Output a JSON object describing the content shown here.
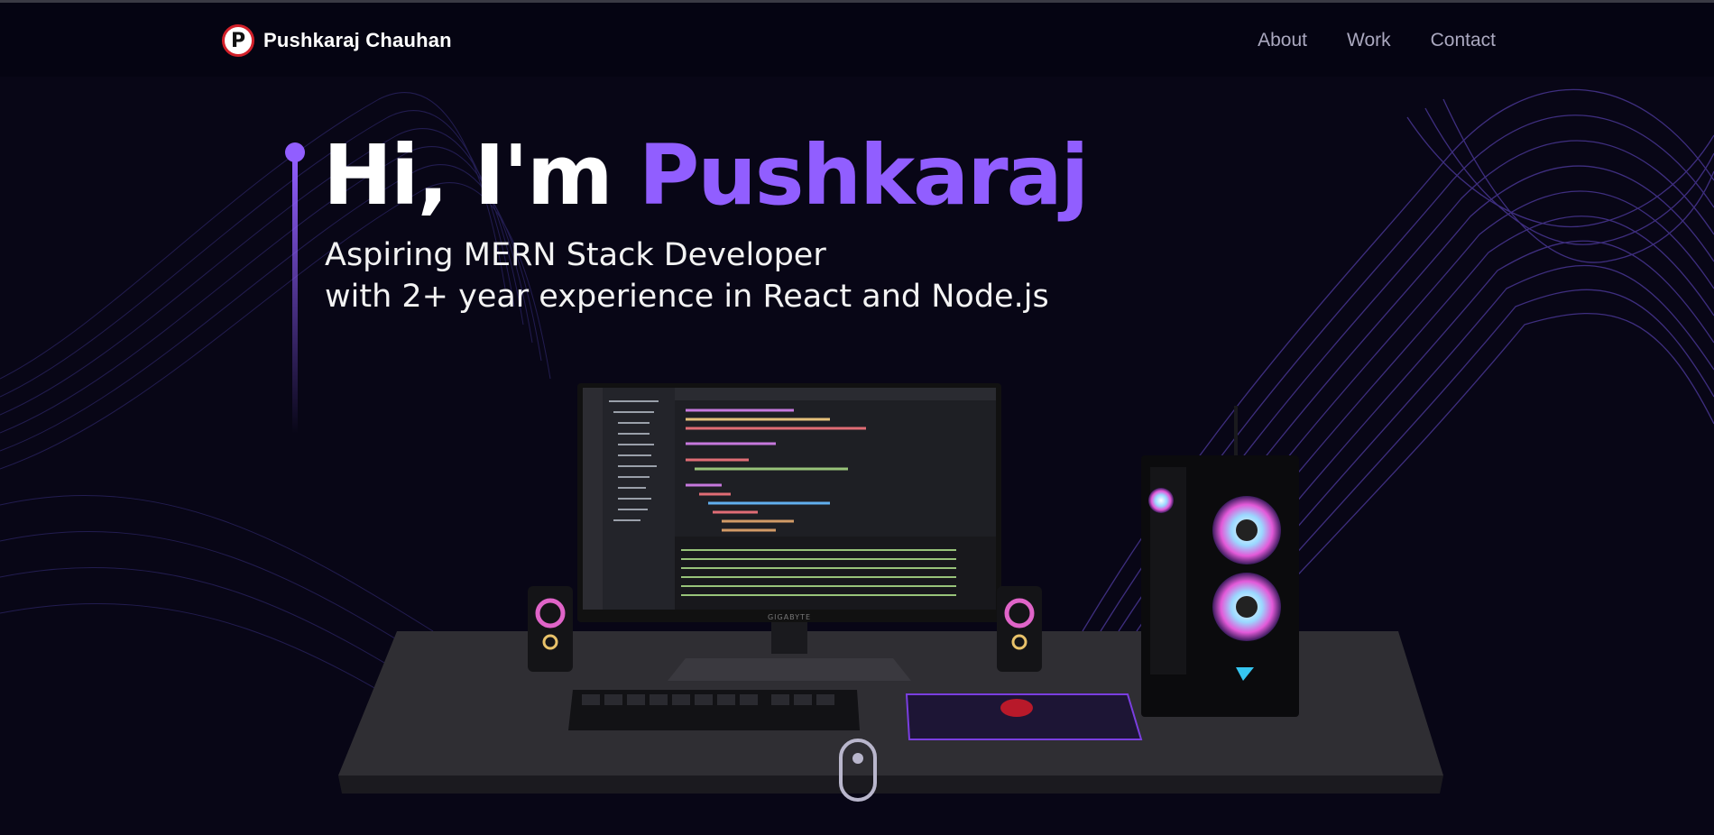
{
  "brand": {
    "logo_letter": "P",
    "name": "Pushkaraj Chauhan"
  },
  "nav": {
    "items": [
      "About",
      "Work",
      "Contact"
    ]
  },
  "hero": {
    "greeting": "Hi, I'm",
    "name": "Pushkaraj",
    "subtitle_line1": "Aspiring MERN Stack Developer",
    "subtitle_line2": "with 2+ year experience in React and Node.js"
  },
  "scene": {
    "monitor_brand": "GIGABYTE"
  },
  "colors": {
    "accent": "#915eff",
    "background": "#080616",
    "logo_ring": "#d3202a"
  }
}
